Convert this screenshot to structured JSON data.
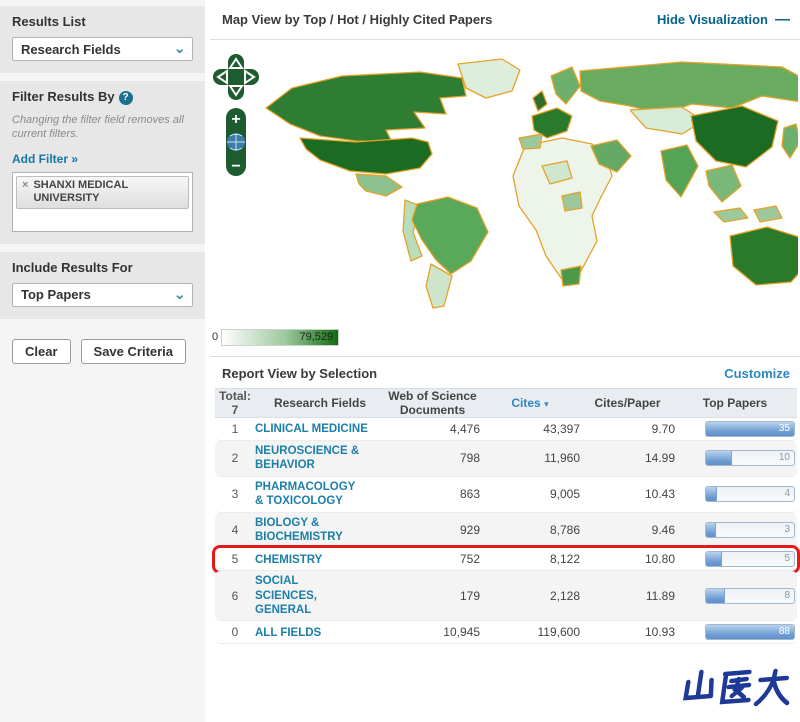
{
  "sidebar": {
    "results_list_label": "Results List",
    "results_list_value": "Research Fields",
    "chevron": "⌄",
    "filter_by_label": "Filter Results By",
    "help_glyph": "?",
    "filter_note": "Changing the filter field removes all current filters.",
    "add_filter_label": "Add Filter »",
    "chip_remove": "×",
    "filter_chip": "SHANXI MEDICAL UNIVERSITY",
    "include_results_label": "Include Results For",
    "include_results_value": "Top Papers",
    "clear_label": "Clear",
    "save_label": "Save Criteria"
  },
  "map": {
    "title": "Map View by Top / Hot / Highly Cited Papers",
    "hide_viz_label": "Hide Visualization",
    "minus_glyph": "—",
    "zoom_in_glyph": "+",
    "zoom_out_glyph": "−",
    "legend_min": "0",
    "legend_max": "79,529"
  },
  "report": {
    "title": "Report View by Selection",
    "customize_label": "Customize",
    "total_label": "Total:",
    "total_value": "7",
    "col_field": "Research Fields",
    "col_docs": "Web of Science Documents",
    "col_cites": "Cites",
    "sort_arrow": "▾",
    "col_cpp": "Cites/Paper",
    "col_papers": "Top Papers",
    "rows": [
      {
        "rank": "1",
        "field": "CLINICAL MEDICINE",
        "docs": "4,476",
        "cites": "43,397",
        "cpp": "9.70",
        "papers": "35",
        "fill": 100,
        "highlighted": false
      },
      {
        "rank": "2",
        "field": "NEUROSCIENCE & BEHAVIOR",
        "docs": "798",
        "cites": "11,960",
        "cpp": "14.99",
        "papers": "10",
        "fill": 30,
        "highlighted": false
      },
      {
        "rank": "3",
        "field": "PHARMACOLOGY & TOXICOLOGY",
        "docs": "863",
        "cites": "9,005",
        "cpp": "10.43",
        "papers": "4",
        "fill": 13,
        "highlighted": false
      },
      {
        "rank": "4",
        "field": "BIOLOGY & BIOCHEMISTRY",
        "docs": "929",
        "cites": "8,786",
        "cpp": "9.46",
        "papers": "3",
        "fill": 11,
        "highlighted": false
      },
      {
        "rank": "5",
        "field": "CHEMISTRY",
        "docs": "752",
        "cites": "8,122",
        "cpp": "10.80",
        "papers": "5",
        "fill": 18,
        "highlighted": true
      },
      {
        "rank": "6",
        "field": "SOCIAL SCIENCES, GENERAL",
        "docs": "179",
        "cites": "2,128",
        "cpp": "11.89",
        "papers": "8",
        "fill": 22,
        "highlighted": false
      },
      {
        "rank": "0",
        "field": "ALL FIELDS",
        "docs": "10,945",
        "cites": "119,600",
        "cpp": "10.93",
        "papers": "88",
        "fill": 100,
        "highlighted": false
      }
    ]
  },
  "watermark_text": "山医大",
  "colors": {
    "link_teal": "#1b7fa8",
    "hide_viz": "#056388",
    "customize_blue": "#2b87c0",
    "map_dark_green": "#1c6b22",
    "map_mid_green": "#5aa85a",
    "map_light_green": "#d9ecd6",
    "map_border_orange": "#e6a228",
    "highlight_red": "#e31a1a",
    "bar_blue": "#6d9cd3",
    "watermark_blue": "#1e3a96"
  }
}
